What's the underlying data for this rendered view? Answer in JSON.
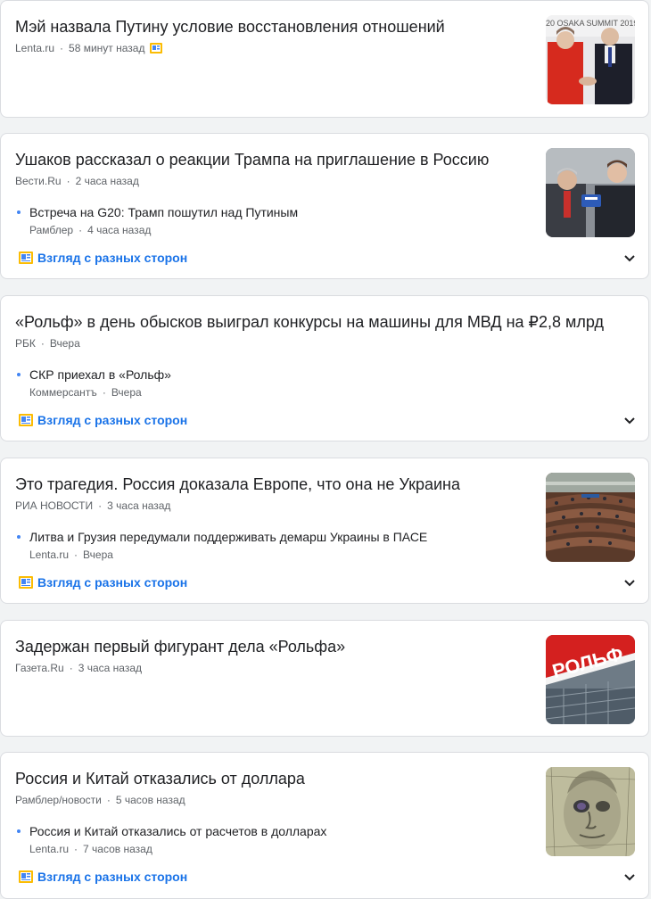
{
  "colors": {
    "accent": "#1a73e8",
    "meta": "#5f6368",
    "bullet": "#4285f4"
  },
  "articles": [
    {
      "title": "Мэй назвала Путину условие восстановления отношений",
      "source": "Lenta.ru",
      "time": "58 минут назад",
      "thumb_icon": "handshake-photo",
      "thumb_text": "20 OSAKA SUMMIT 2019"
    },
    {
      "title": "Ушаков рассказал о реакции Трампа на приглашение в Россию",
      "source": "Вести.Ru",
      "time": "2 часа назад",
      "thumb_icon": "interview-photo",
      "sub": {
        "title": "Встреча на G20: Трамп пошутил над Путиным",
        "source": "Рамблер",
        "time": "4 часа назад"
      },
      "full_coverage": "Взгляд с разных сторон"
    },
    {
      "title": "«Рольф» в день обысков выиграл конкурсы на машины для МВД на ₽2,8 млрд",
      "source": "РБК",
      "time": "Вчера",
      "sub": {
        "title": "СКР приехал в «Рольф»",
        "source": "Коммерсантъ",
        "time": "Вчера"
      },
      "full_coverage": "Взгляд с разных сторон"
    },
    {
      "title": "Это трагедия. Россия доказала Европе, что она не Украина",
      "source": "РИА НОВОСТИ",
      "time": "3 часа назад",
      "thumb_icon": "assembly-hall-photo",
      "sub": {
        "title": "Литва и Грузия передумали поддерживать демарш Украины в ПАСЕ",
        "source": "Lenta.ru",
        "time": "Вчера"
      },
      "full_coverage": "Взгляд с разных сторон"
    },
    {
      "title": "Задержан первый фигурант дела «Рольфа»",
      "source": "Газета.Ru",
      "time": "3 часа назад",
      "thumb_icon": "rolf-sign-photo",
      "thumb_text": "РОЛЬФ"
    },
    {
      "title": "Россия и Китай отказались от доллара",
      "source": "Рамблер/новости",
      "time": "5 часов назад",
      "thumb_icon": "dollar-bill-photo",
      "sub": {
        "title": "Россия и Китай отказались от расчетов в долларах",
        "source": "Lenta.ru",
        "time": "7 часов назад"
      },
      "full_coverage": "Взгляд с разных сторон"
    }
  ]
}
